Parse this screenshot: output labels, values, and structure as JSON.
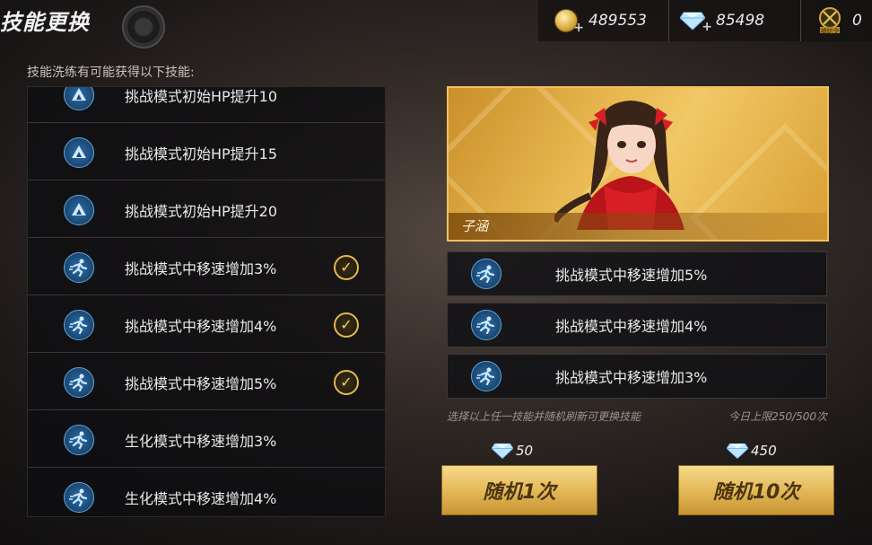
{
  "header": {
    "title": "技能更换",
    "gold": "489553",
    "diamonds": "85498",
    "medal_label": "補給令",
    "medal_count": "0"
  },
  "subtitle": "技能洗练有可能获得以下技能:",
  "skill_list": [
    {
      "label": "挑战模式初始HP提升10",
      "icon": "arrow-up-icon",
      "checked": false
    },
    {
      "label": "挑战模式初始HP提升15",
      "icon": "arrow-up-icon",
      "checked": false
    },
    {
      "label": "挑战模式初始HP提升20",
      "icon": "arrow-up-icon",
      "checked": false
    },
    {
      "label": "挑战模式中移速增加3%",
      "icon": "runner-icon",
      "checked": true
    },
    {
      "label": "挑战模式中移速增加4%",
      "icon": "runner-icon",
      "checked": true
    },
    {
      "label": "挑战模式中移速增加5%",
      "icon": "runner-icon",
      "checked": true
    },
    {
      "label": "生化模式中移速增加3%",
      "icon": "runner-icon",
      "checked": false
    },
    {
      "label": "生化模式中移速增加4%",
      "icon": "runner-icon",
      "checked": false
    }
  ],
  "character": {
    "name": "子涵"
  },
  "current_skills": [
    {
      "label": "挑战模式中移速增加5%",
      "icon": "runner-icon"
    },
    {
      "label": "挑战模式中移速增加4%",
      "icon": "runner-icon"
    },
    {
      "label": "挑战模式中移速增加3%",
      "icon": "runner-icon"
    }
  ],
  "hint": "选择以上任一技能并随机刷新可更换技能",
  "daily_limit": "今日上限250/500次",
  "actions": {
    "random_once": {
      "label": "随机1次",
      "cost": "50"
    },
    "random_ten": {
      "label": "随机10次",
      "cost": "450"
    }
  },
  "colors": {
    "accent_gold": "#e4b95a",
    "icon_blue": "#2a6fa8",
    "check_gold": "#e5b94a"
  }
}
